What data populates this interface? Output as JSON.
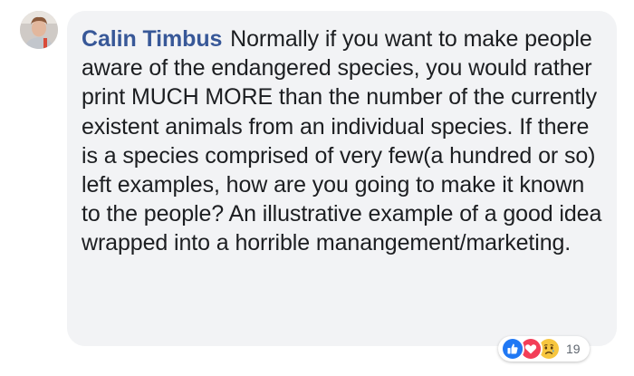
{
  "comment": {
    "author_name": "Calin Timbus",
    "text": "Normally if you want to make people aware of the endangered species, you would rather print MUCH MORE than the number of the currently existent animals from an individual species. If there is a species comprised of very few(a hundred or so) left examples, how are you going to make it known to the people? An illustrative example of a good idea wrapped into a horrible manangement/marketing."
  },
  "reactions": {
    "icons": [
      "like-icon",
      "love-icon",
      "sad-icon"
    ],
    "count": "19"
  },
  "colors": {
    "author_name": "#385898",
    "bubble_background": "#f2f3f5",
    "text": "#1c1e21",
    "like": "#2078f4",
    "love": "#f33e58"
  }
}
